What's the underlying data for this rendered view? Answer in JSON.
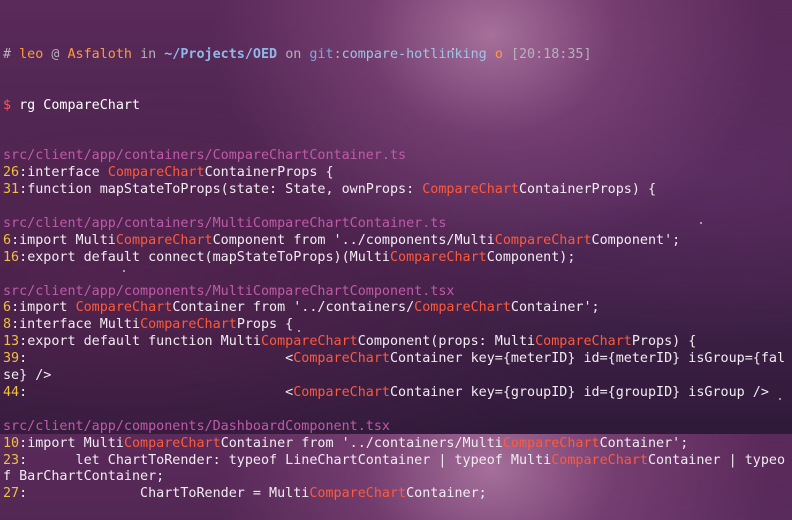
{
  "prompt": {
    "hash": "#",
    "user": "leo",
    "at": "@",
    "host": "Asfaloth",
    "in": "in",
    "path": "~/Projects/OED",
    "on": "on",
    "git": "git",
    "colon": ":",
    "branch": "compare-hotlinking",
    "dirty": "o",
    "time": "[20:18:35]"
  },
  "command": {
    "symbol": "$",
    "text": "rg CompareChart"
  },
  "results": [
    {
      "file": "src/client/app/containers/CompareChartContainer.ts",
      "hits": [
        {
          "ln": "26",
          "parts": [
            "interface ",
            "CompareChart",
            "ContainerProps {"
          ]
        },
        {
          "ln": "31",
          "parts": [
            "function mapStateToProps(state: State, ownProps: ",
            "CompareChart",
            "ContainerProps) {"
          ]
        }
      ]
    },
    {
      "file": "src/client/app/containers/MultiCompareChartContainer.ts",
      "hits": [
        {
          "ln": "6",
          "parts": [
            "import Multi",
            "CompareChart",
            "Component from '../components/Multi",
            "CompareChart",
            "Component';"
          ]
        },
        {
          "ln": "16",
          "parts": [
            "export default connect(mapStateToProps)(Multi",
            "CompareChart",
            "Component);"
          ]
        }
      ]
    },
    {
      "file": "src/client/app/components/MultiCompareChartComponent.tsx",
      "hits": [
        {
          "ln": "6",
          "parts": [
            "import ",
            "CompareChart",
            "Container from '../containers/",
            "CompareChart",
            "Container';"
          ]
        },
        {
          "ln": "8",
          "parts": [
            "interface Multi",
            "CompareChart",
            "Props {"
          ]
        },
        {
          "ln": "13",
          "parts": [
            "export default function Multi",
            "CompareChart",
            "Component(props: Multi",
            "CompareChart",
            "Props) {"
          ]
        },
        {
          "ln": "39",
          "parts": [
            "                                <",
            "CompareChart",
            "Container key={meterID} id={meterID} isGroup={false} />"
          ]
        },
        {
          "ln": "44",
          "parts": [
            "                                <",
            "CompareChart",
            "Container key={groupID} id={groupID} isGroup />"
          ]
        }
      ]
    },
    {
      "file": "src/client/app/components/DashboardComponent.tsx",
      "hits": [
        {
          "ln": "10",
          "parts": [
            "import Multi",
            "CompareChart",
            "Container from '../containers/Multi",
            "CompareChart",
            "Container';"
          ]
        },
        {
          "ln": "23",
          "parts": [
            "      let ChartToRender: typeof LineChartContainer | typeof Multi",
            "CompareChart",
            "Container | typeof BarChartContainer;"
          ]
        },
        {
          "ln": "27",
          "parts": [
            "              ChartToRender = Multi",
            "CompareChart",
            "Container;"
          ]
        }
      ]
    }
  ]
}
